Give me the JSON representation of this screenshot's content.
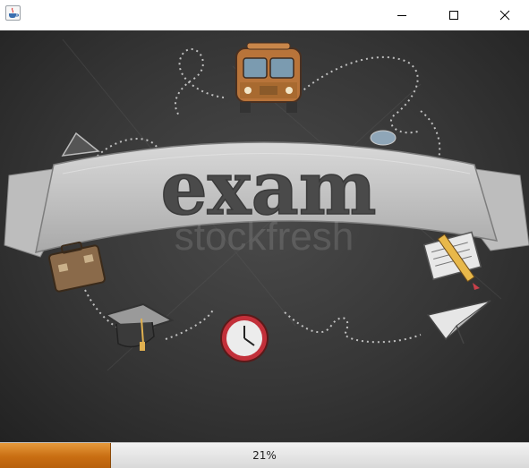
{
  "window": {
    "icon": "java-cup-icon",
    "controls": [
      "minimize-icon",
      "maximize-icon",
      "close-icon"
    ]
  },
  "splash": {
    "banner_text": "exam",
    "watermark_text": "stockfresh"
  },
  "progress": {
    "percent": 21,
    "label": "21%",
    "fill_color": "#cf7418"
  }
}
